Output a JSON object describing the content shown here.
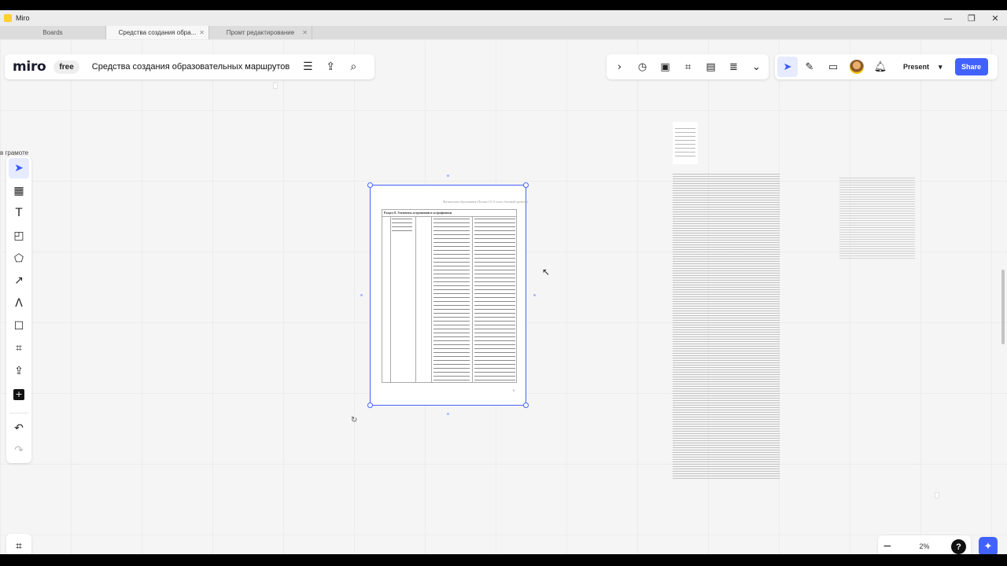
{
  "window": {
    "title": "Miro",
    "controls": [
      "—",
      "❐",
      "✕"
    ]
  },
  "tabs": [
    {
      "label": "Boards",
      "active": false,
      "closable": false
    },
    {
      "label": "Средства создания обра...",
      "active": true,
      "closable": true
    },
    {
      "label": "Промт редактирование",
      "active": false,
      "closable": true
    }
  ],
  "board": {
    "logo": "miro",
    "plan": "free",
    "title": "Средства создания образовательных маршрутов",
    "icons": [
      "menu-icon",
      "export-icon",
      "search-icon"
    ]
  },
  "toolbar_right": {
    "icons": [
      "chevron-right-icon",
      "timer-icon",
      "voting-icon",
      "capture-icon",
      "counter-icon",
      "notes-icon",
      "more-icon"
    ]
  },
  "collab": {
    "icons": [
      "cursor-icon",
      "reactions-icon",
      "comment-icon",
      "avatar",
      "bell-icon"
    ],
    "present_label": "Present",
    "share_label": "Share"
  },
  "left_tools": [
    {
      "name": "select-tool",
      "icon": "cursor-icon",
      "active": true
    },
    {
      "name": "templates-tool",
      "icon": "template-icon"
    },
    {
      "name": "text-tool",
      "icon": "text-icon"
    },
    {
      "name": "sticky-note-tool",
      "icon": "sticky-note-icon"
    },
    {
      "name": "shapes-tool",
      "icon": "shapes-icon"
    },
    {
      "name": "connector-tool",
      "icon": "arrow-icon"
    },
    {
      "name": "pen-tool",
      "icon": "pen-icon"
    },
    {
      "name": "comment-tool",
      "icon": "comment-icon"
    },
    {
      "name": "frame-tool",
      "icon": "frame-icon"
    },
    {
      "name": "upload-tool",
      "icon": "upload-icon"
    },
    {
      "name": "more-tools",
      "icon": "plus-icon"
    }
  ],
  "zoom": {
    "level": "2%"
  },
  "canvas": {
    "edge_text": "в грамоте",
    "doc_header": "Физическая образования (Логика 10-11 класс базовый уровень)",
    "doc_caption": "Раздел 8. Элементы астрономии и астрофизики",
    "doc_page_number": "9"
  },
  "colors": {
    "accent": "#4262ff",
    "brand_yellow": "#ffd02f"
  }
}
